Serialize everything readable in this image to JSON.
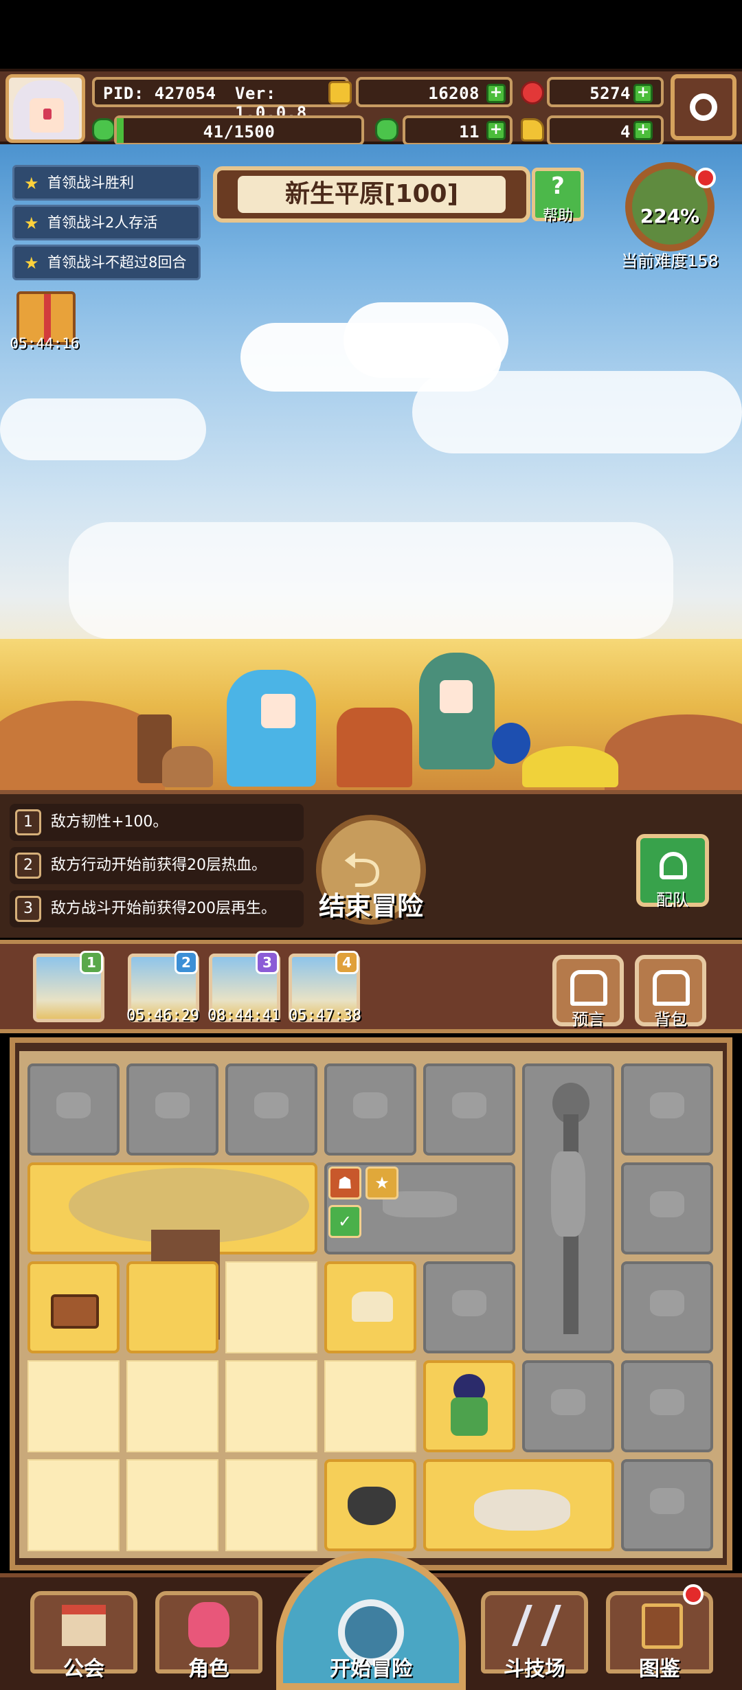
{
  "hud": {
    "pid": "PID: 427054",
    "version": "Ver: 1.0.0.8",
    "gold": "16208",
    "gems": "5274",
    "stamina": "41/1500",
    "clover": "11",
    "keys": "4",
    "stamina_fill": 0.027
  },
  "quests": [
    "首领战斗胜利",
    "首领战斗2人存活",
    "首领战斗不超过8回合"
  ],
  "stage": {
    "title": "新生平原[100]",
    "help": "帮助"
  },
  "difficulty": {
    "percent": "224%",
    "label": "当前难度158"
  },
  "gift_timer": "05:44:16",
  "effects": [
    {
      "num": "1",
      "text": "敌方韧性+100。"
    },
    {
      "num": "2",
      "text": "敌方行动开始前获得20层热血。"
    },
    {
      "num": "3",
      "text": "敌方战斗开始前获得200层再生。"
    }
  ],
  "end_adventure": "结束冒险",
  "team": "配队",
  "slots": [
    {
      "badge": "1",
      "color": "#5aa84a",
      "timer": ""
    },
    {
      "badge": "2",
      "color": "#3b8fd6",
      "timer": "05:46:29"
    },
    {
      "badge": "3",
      "color": "#8b5cd6",
      "timer": "08:44:41"
    },
    {
      "badge": "4",
      "color": "#e0a03a",
      "timer": "05:47:38"
    }
  ],
  "side_buttons": {
    "prophecy": "预言",
    "backpack": "背包"
  },
  "nav": {
    "guild": "公会",
    "character": "角色",
    "start": "开始冒险",
    "arena": "斗技场",
    "codex": "图鉴"
  }
}
